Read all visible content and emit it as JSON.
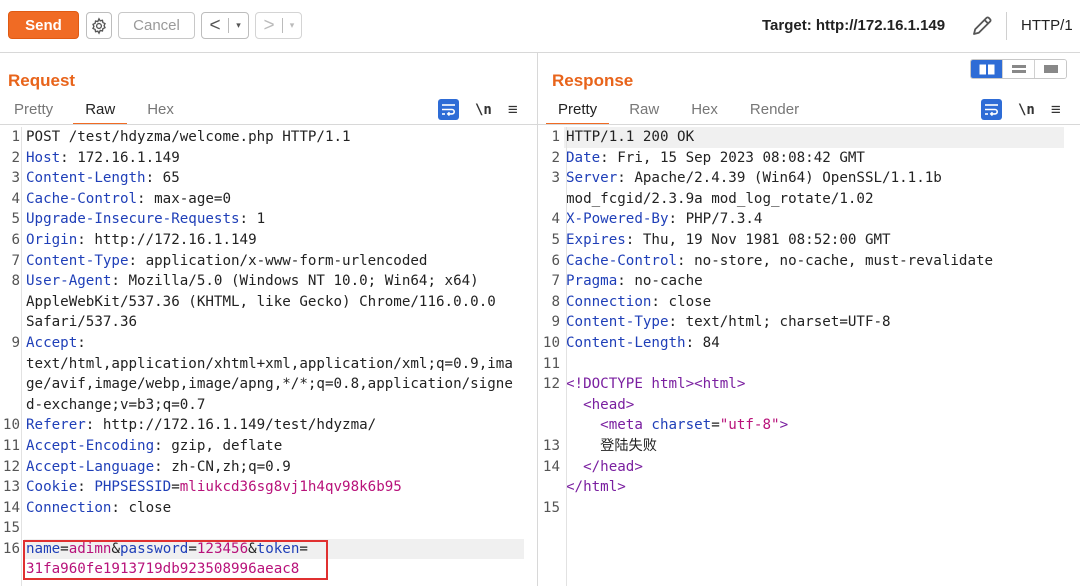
{
  "toolbar": {
    "send_label": "Send",
    "cancel_label": "Cancel",
    "back_arrow": "<",
    "forward_arrow": ">",
    "dropdown_glyph": "▾",
    "target_label": "Target: http://172.16.1.149",
    "http_version": "HTTP/1"
  },
  "request": {
    "title": "Request",
    "tabs": [
      "Pretty",
      "Raw",
      "Hex"
    ],
    "active_tab": "Raw",
    "newline_label": "\\n",
    "menu_glyph": "≡",
    "lines": [
      {
        "n": "1",
        "parts": [
          {
            "t": "POST /test/hdyzma/welcome.php HTTP/1.1",
            "c": ""
          }
        ]
      },
      {
        "n": "2",
        "parts": [
          {
            "t": "Host",
            "c": "hk"
          },
          {
            "t": ": 172.16.1.149",
            "c": ""
          }
        ]
      },
      {
        "n": "3",
        "parts": [
          {
            "t": "Content-Length",
            "c": "hk"
          },
          {
            "t": ": 65",
            "c": ""
          }
        ]
      },
      {
        "n": "4",
        "parts": [
          {
            "t": "Cache-Control",
            "c": "hk"
          },
          {
            "t": ": max-age=0",
            "c": ""
          }
        ]
      },
      {
        "n": "5",
        "parts": [
          {
            "t": "Upgrade-Insecure-Requests",
            "c": "hk"
          },
          {
            "t": ": 1",
            "c": ""
          }
        ]
      },
      {
        "n": "6",
        "parts": [
          {
            "t": "Origin",
            "c": "hk"
          },
          {
            "t": ": http://172.16.1.149",
            "c": ""
          }
        ]
      },
      {
        "n": "7",
        "parts": [
          {
            "t": "Content-Type",
            "c": "hk"
          },
          {
            "t": ": application/x-www-form-urlencoded",
            "c": ""
          }
        ]
      },
      {
        "n": "8",
        "parts": [
          {
            "t": "User-Agent",
            "c": "hk"
          },
          {
            "t": ": Mozilla/5.0 (Windows NT 10.0; Win64; x64)",
            "c": ""
          }
        ]
      },
      {
        "n": "",
        "parts": [
          {
            "t": "AppleWebKit/537.36 (KHTML, like Gecko) Chrome/116.0.0.0",
            "c": ""
          }
        ]
      },
      {
        "n": "",
        "parts": [
          {
            "t": "Safari/537.36",
            "c": ""
          }
        ]
      },
      {
        "n": "9",
        "parts": [
          {
            "t": "Accept",
            "c": "hk"
          },
          {
            "t": ":",
            "c": ""
          }
        ]
      },
      {
        "n": "",
        "parts": [
          {
            "t": "text/html,application/xhtml+xml,application/xml;q=0.9,ima",
            "c": ""
          }
        ]
      },
      {
        "n": "",
        "parts": [
          {
            "t": "ge/avif,image/webp,image/apng,*/*;q=0.8,application/signe",
            "c": ""
          }
        ]
      },
      {
        "n": "",
        "parts": [
          {
            "t": "d-exchange;v=b3;q=0.7",
            "c": ""
          }
        ]
      },
      {
        "n": "10",
        "parts": [
          {
            "t": "Referer",
            "c": "hk"
          },
          {
            "t": ": http://172.16.1.149/test/hdyzma/",
            "c": ""
          }
        ]
      },
      {
        "n": "11",
        "parts": [
          {
            "t": "Accept-Encoding",
            "c": "hk"
          },
          {
            "t": ": gzip, deflate",
            "c": ""
          }
        ]
      },
      {
        "n": "12",
        "parts": [
          {
            "t": "Accept-Language",
            "c": "hk"
          },
          {
            "t": ": zh-CN,zh;q=0.9",
            "c": ""
          }
        ]
      },
      {
        "n": "13",
        "parts": [
          {
            "t": "Cookie",
            "c": "hk"
          },
          {
            "t": ": ",
            "c": ""
          },
          {
            "t": "PHPSESSID",
            "c": "hk"
          },
          {
            "t": "=",
            "c": ""
          },
          {
            "t": "mliukcd36sg8vj1h4qv98k6b95",
            "c": "pv"
          }
        ]
      },
      {
        "n": "14",
        "parts": [
          {
            "t": "Connection",
            "c": "hk"
          },
          {
            "t": ": close",
            "c": ""
          }
        ]
      },
      {
        "n": "15",
        "parts": [
          {
            "t": "",
            "c": ""
          }
        ]
      },
      {
        "n": "16",
        "hl": true,
        "parts": [
          {
            "t": "name",
            "c": "hk"
          },
          {
            "t": "=",
            "c": ""
          },
          {
            "t": "adimn",
            "c": "pv"
          },
          {
            "t": "&",
            "c": ""
          },
          {
            "t": "password",
            "c": "hk"
          },
          {
            "t": "=",
            "c": ""
          },
          {
            "t": "123456",
            "c": "pv"
          },
          {
            "t": "&",
            "c": ""
          },
          {
            "t": "token",
            "c": "hk"
          },
          {
            "t": "=",
            "c": ""
          }
        ]
      },
      {
        "n": "",
        "parts": [
          {
            "t": "31fa960fe1913719db923508996aeac8",
            "c": "pv"
          }
        ]
      }
    ]
  },
  "response": {
    "title": "Response",
    "tabs": [
      "Pretty",
      "Raw",
      "Hex",
      "Render"
    ],
    "active_tab": "Pretty",
    "newline_label": "\\n",
    "menu_glyph": "≡",
    "lines": [
      {
        "n": "1",
        "hl": true,
        "parts": [
          {
            "t": "HTTP/1.1 200 OK",
            "c": ""
          }
        ]
      },
      {
        "n": "2",
        "parts": [
          {
            "t": "Date",
            "c": "hk"
          },
          {
            "t": ": Fri, 15 Sep 2023 08:08:42 GMT",
            "c": ""
          }
        ]
      },
      {
        "n": "3",
        "parts": [
          {
            "t": "Server",
            "c": "hk"
          },
          {
            "t": ": Apache/2.4.39 (Win64) OpenSSL/1.1.1b",
            "c": ""
          }
        ]
      },
      {
        "n": "",
        "parts": [
          {
            "t": "mod_fcgid/2.3.9a mod_log_rotate/1.02",
            "c": ""
          }
        ]
      },
      {
        "n": "4",
        "parts": [
          {
            "t": "X-Powered-By",
            "c": "hk"
          },
          {
            "t": ": PHP/7.3.4",
            "c": ""
          }
        ]
      },
      {
        "n": "5",
        "parts": [
          {
            "t": "Expires",
            "c": "hk"
          },
          {
            "t": ": Thu, 19 Nov 1981 08:52:00 GMT",
            "c": ""
          }
        ]
      },
      {
        "n": "6",
        "parts": [
          {
            "t": "Cache-Control",
            "c": "hk"
          },
          {
            "t": ": no-store, no-cache, must-revalidate",
            "c": ""
          }
        ]
      },
      {
        "n": "7",
        "parts": [
          {
            "t": "Pragma",
            "c": "hk"
          },
          {
            "t": ": no-cache",
            "c": ""
          }
        ]
      },
      {
        "n": "8",
        "parts": [
          {
            "t": "Connection",
            "c": "hk"
          },
          {
            "t": ": close",
            "c": ""
          }
        ]
      },
      {
        "n": "9",
        "parts": [
          {
            "t": "Content-Type",
            "c": "hk"
          },
          {
            "t": ": text/html; charset=UTF-8",
            "c": ""
          }
        ]
      },
      {
        "n": "10",
        "parts": [
          {
            "t": "Content-Length",
            "c": "hk"
          },
          {
            "t": ": 84",
            "c": ""
          }
        ]
      },
      {
        "n": "11",
        "parts": [
          {
            "t": "",
            "c": ""
          }
        ]
      },
      {
        "n": "12",
        "parts": [
          {
            "t": "<!DOCTYPE html>",
            "c": "tag"
          },
          {
            "t": "<html>",
            "c": "tag"
          }
        ]
      },
      {
        "n": "",
        "parts": [
          {
            "t": "  ",
            "c": ""
          },
          {
            "t": "<head>",
            "c": "tag"
          }
        ]
      },
      {
        "n": "",
        "parts": [
          {
            "t": "    ",
            "c": ""
          },
          {
            "t": "<meta ",
            "c": "tag"
          },
          {
            "t": "charset",
            "c": "atn"
          },
          {
            "t": "=",
            "c": ""
          },
          {
            "t": "\"utf-8\"",
            "c": "atv"
          },
          {
            "t": ">",
            "c": "tag"
          }
        ]
      },
      {
        "n": "13",
        "parts": [
          {
            "t": "    登陆失败",
            "c": ""
          }
        ]
      },
      {
        "n": "14",
        "parts": [
          {
            "t": "  ",
            "c": ""
          },
          {
            "t": "</head>",
            "c": "tag"
          }
        ]
      },
      {
        "n": "",
        "parts": [
          {
            "t": "</html>",
            "c": "tag"
          }
        ]
      },
      {
        "n": "15",
        "parts": [
          {
            "t": "",
            "c": ""
          }
        ]
      }
    ]
  },
  "colors": {
    "accent": "#f06b24",
    "header_key": "#1f3fb8",
    "param_value": "#b8127a",
    "tag": "#7a1fa0",
    "highlight_box": "#e03030",
    "toggle_active": "#2e6cd6"
  }
}
